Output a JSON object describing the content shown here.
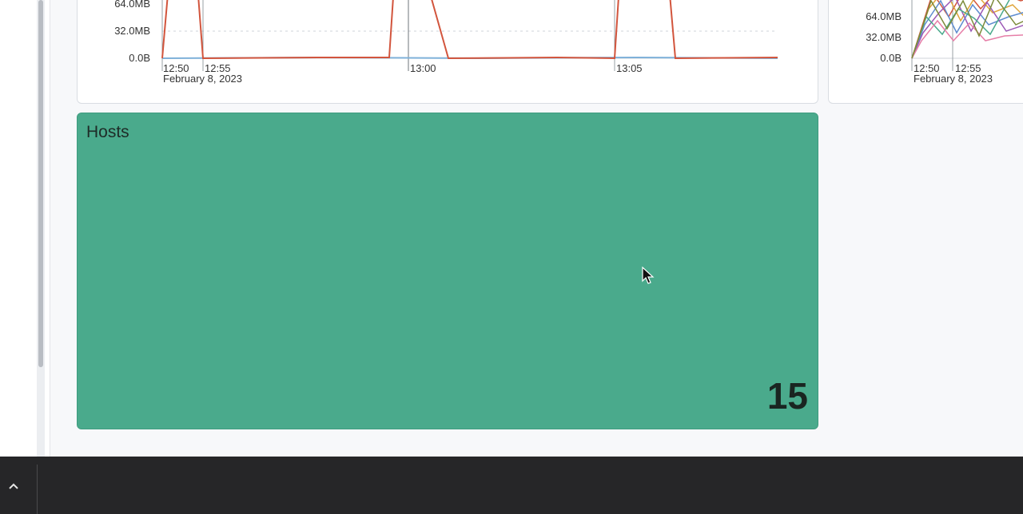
{
  "panels": {
    "memory_chart_left": {
      "y_ticks": [
        "64.0MB",
        "32.0MB",
        "0.0B"
      ],
      "x_ticks": [
        "12:50",
        "12:55",
        "13:00",
        "13:05"
      ],
      "x_date": "February 8, 2023",
      "colors": {
        "series_main": "#d2553d",
        "baseline": "#7fb1d9",
        "grid": "#cfd3d8"
      }
    },
    "memory_chart_right": {
      "y_ticks": [
        "64.0MB",
        "32.0MB",
        "0.0B"
      ],
      "x_ticks": [
        "12:50",
        "12:55"
      ],
      "x_date": "February 8, 2023",
      "colors": [
        "#d2553d",
        "#e0a43a",
        "#5e8ccf",
        "#9b59b6",
        "#4aaa8c",
        "#e67ea7",
        "#7c8b3a"
      ]
    },
    "hosts": {
      "title": "Hosts",
      "value": "15",
      "background": "#4aaa8c"
    }
  },
  "taskbar": {
    "expand_icon": "chevron-up-icon"
  }
}
